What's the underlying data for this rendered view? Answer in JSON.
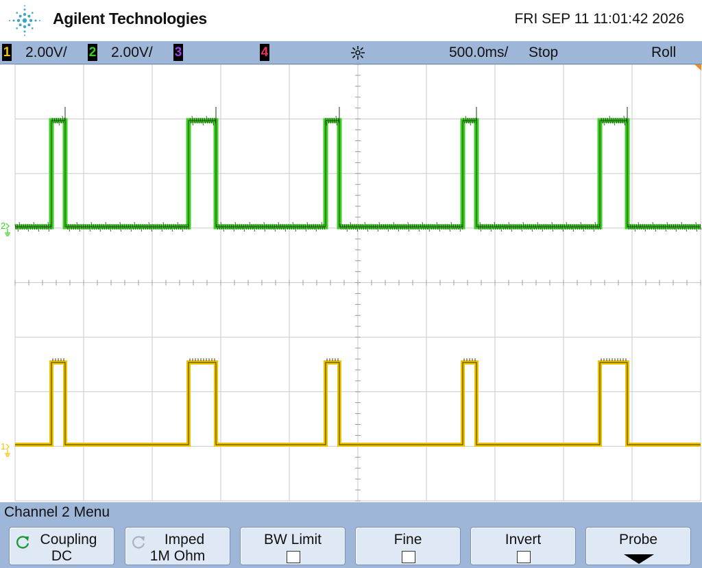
{
  "header": {
    "brand": "Agilent Technologies",
    "datetime": "FRI SEP 11 11:01:42 2026"
  },
  "statusbar": {
    "ch1": {
      "number": "1",
      "scale": "2.00V/",
      "color": "#f2c200"
    },
    "ch2": {
      "number": "2",
      "scale": "2.00V/",
      "color": "#38d11f"
    },
    "ch3": {
      "number": "3",
      "color": "#9b3fe6"
    },
    "ch4": {
      "number": "4",
      "color": "#e8335f"
    },
    "timebase": "500.0ms/",
    "run_state": "Stop",
    "mode": "Roll"
  },
  "waveforms": {
    "ch2": {
      "ground_marker": "2",
      "color": "#38d11f"
    },
    "ch1": {
      "ground_marker": "1",
      "color": "#f2c200"
    }
  },
  "menu": {
    "title": "Channel 2  Menu",
    "softkeys": [
      {
        "label": "Coupling",
        "value": "DC",
        "icon": "rotate-icon",
        "active": true
      },
      {
        "label": "Imped",
        "value": "1M Ohm",
        "icon": "rotate-icon",
        "active": false
      },
      {
        "label": "BW Limit",
        "type": "checkbox",
        "checked": false
      },
      {
        "label": "Fine",
        "type": "checkbox",
        "checked": false
      },
      {
        "label": "Invert",
        "type": "checkbox",
        "checked": false
      },
      {
        "label": "Probe",
        "icon": "arrow-down-icon"
      }
    ]
  }
}
